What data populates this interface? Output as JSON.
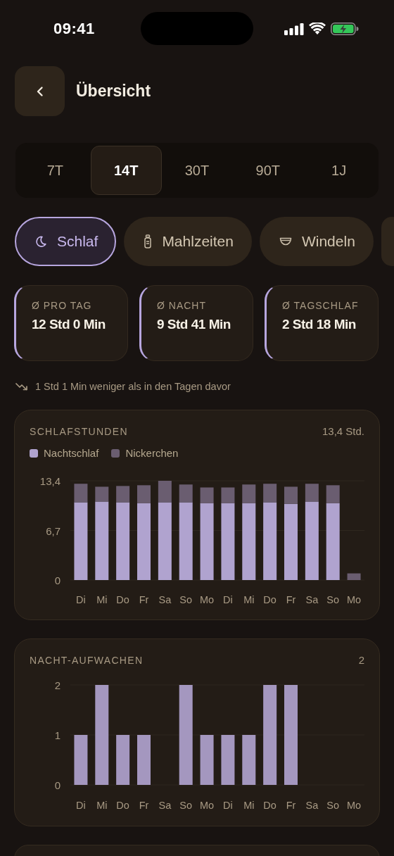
{
  "status_bar": {
    "time": "09:41"
  },
  "header": {
    "title": "Übersicht"
  },
  "range_tabs": [
    {
      "label": "7T",
      "selected": false
    },
    {
      "label": "14T",
      "selected": true
    },
    {
      "label": "30T",
      "selected": false
    },
    {
      "label": "90T",
      "selected": false
    },
    {
      "label": "1J",
      "selected": false
    }
  ],
  "categories": [
    {
      "label": "Schlaf",
      "kind": "moon",
      "selected": true
    },
    {
      "label": "Mahlzeiten",
      "kind": "bottle",
      "selected": false
    },
    {
      "label": "Windeln",
      "kind": "diaper",
      "selected": false
    }
  ],
  "stats": [
    {
      "label": "Ø PRO TAG",
      "value": "12 Std 0 Min"
    },
    {
      "label": "Ø NACHT",
      "value": "9 Std 41 Min"
    },
    {
      "label": "Ø TAGSCHLAF",
      "value": "2 Std 18 Min"
    }
  ],
  "trend": {
    "text": "1 Std 1 Min weniger als in den Tagen davor"
  },
  "sleep_card": {
    "title": "SCHLAFSTUNDEN",
    "summary": "13,4 Std.",
    "chart_data": {
      "type": "bar",
      "stacked": true,
      "categories": [
        "Di",
        "Mi",
        "Do",
        "Fr",
        "Sa",
        "So",
        "Mo",
        "Di",
        "Mi",
        "Do",
        "Fr",
        "Sa",
        "So",
        "Mo"
      ],
      "series": [
        {
          "name": "Nachtschlaf",
          "color": "#b0a3cf",
          "values": [
            10.5,
            10.6,
            10.5,
            10.4,
            10.5,
            10.5,
            10.4,
            10.4,
            10.4,
            10.5,
            10.3,
            10.6,
            10.4,
            0
          ]
        },
        {
          "name": "Nickerchen",
          "color": "#6a5d70",
          "values": [
            2.5,
            2.0,
            2.2,
            2.4,
            2.9,
            2.4,
            2.1,
            2.1,
            2.5,
            2.5,
            2.3,
            2.4,
            2.4,
            0.9
          ]
        }
      ],
      "ylim": [
        0,
        13.4
      ],
      "yticks": [
        0,
        {
          "value": 6.7,
          "label": "6,7"
        },
        {
          "value": 13.4,
          "label": "13,4"
        }
      ]
    }
  },
  "wake_card": {
    "title": "NACHT-AUFWACHEN",
    "summary": "2",
    "chart_data": {
      "type": "bar",
      "categories": [
        "Di",
        "Mi",
        "Do",
        "Fr",
        "Sa",
        "So",
        "Mo",
        "Di",
        "Mi",
        "Do",
        "Fr",
        "Sa",
        "So",
        "Mo"
      ],
      "values": [
        1,
        2,
        1,
        1,
        0,
        2,
        1,
        1,
        1,
        2,
        2,
        0,
        0,
        0
      ],
      "ylim": [
        0,
        2
      ],
      "yticks": [
        0,
        1,
        2
      ]
    }
  }
}
